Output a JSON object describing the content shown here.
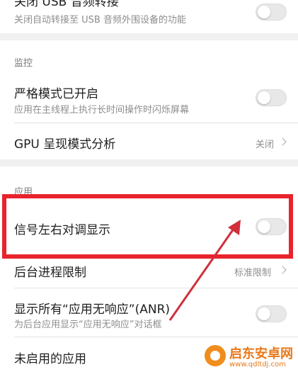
{
  "top_item": {
    "title": "关闭 USB 音频转接",
    "subtitle": "关闭自动转接至 USB 音频外围设备的功能"
  },
  "monitoring": {
    "header": "监控",
    "strict_mode": {
      "title": "严格模式已开启",
      "subtitle": "应用在主线程上执行长时间操作时闪烁屏幕"
    },
    "gpu_profile": {
      "title": "GPU 呈现模式分析",
      "value": "关闭"
    }
  },
  "apps": {
    "header": "应用",
    "swap_signal": {
      "title": "信号左右对调显示"
    },
    "bg_limit": {
      "title": "后台进程限制",
      "value": "标准限制"
    },
    "anr": {
      "title": "显示所有“应用无响应”(ANR)",
      "subtitle": "为后台应用显示“应用无响应”对话框"
    },
    "inactive_apps": {
      "title": "未启用的应用"
    }
  },
  "watermark": {
    "name": "启东安卓网",
    "url": "www.qdltdj.com"
  },
  "colors": {
    "highlight": "#e8232c",
    "arrow": "#d0303a",
    "watermark": "#e97819"
  }
}
